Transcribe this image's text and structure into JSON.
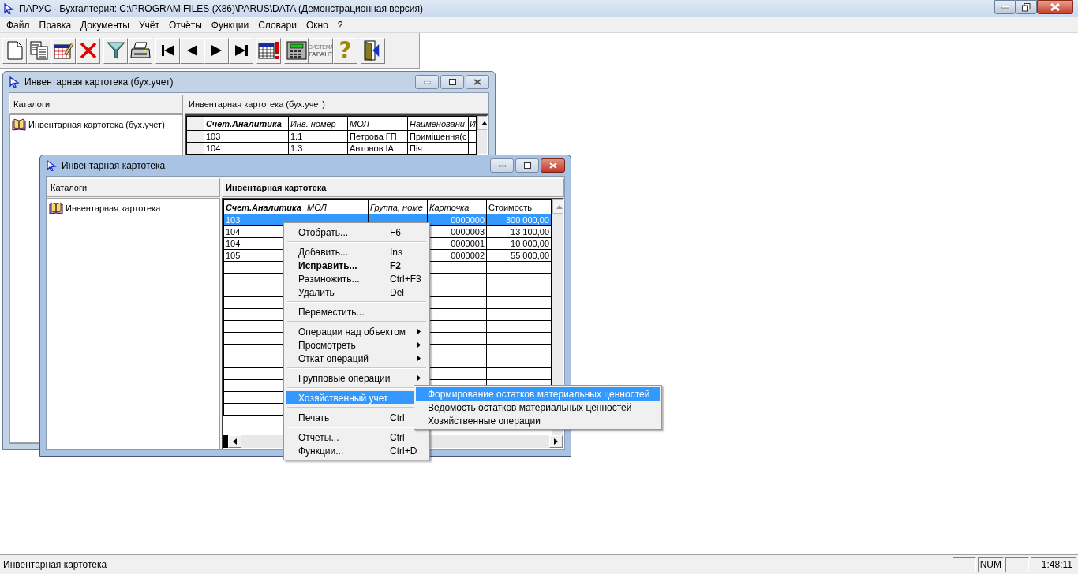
{
  "app_window": {
    "title": "ПАРУС - Бухгалтерия: C:\\PROGRAM FILES (X86)\\PARUS\\DATA (Демонстрационная версия)"
  },
  "menu_bar": [
    "Файл",
    "Правка",
    "Документы",
    "Учёт",
    "Отчёты",
    "Функции",
    "Словари",
    "Окно",
    "?"
  ],
  "toolbar": [
    [
      {
        "kind": "new"
      },
      {
        "kind": "copy"
      },
      {
        "kind": "edit"
      },
      {
        "kind": "delete"
      }
    ],
    [
      {
        "kind": "filter"
      },
      {
        "kind": "print"
      }
    ],
    [
      {
        "kind": "first"
      },
      {
        "kind": "prev"
      },
      {
        "kind": "next"
      },
      {
        "kind": "last"
      }
    ],
    [
      {
        "kind": "alert"
      }
    ],
    [
      {
        "kind": "calculator"
      },
      {
        "kind": "logo",
        "lines": [
          "СИСТЕМА",
          "ГАРАНТ"
        ],
        "disabled": true
      },
      {
        "kind": "help",
        "text": "?"
      }
    ],
    [
      {
        "kind": "exit"
      }
    ]
  ],
  "windows": [
    {
      "title": "Инвентарная картотека (бух.учет)",
      "active": false,
      "catalog_header": "Каталоги",
      "tree_item": "Инвентарная картотека (бух.учет)",
      "list_header": "Инвентарная картотека (бух.учет)",
      "row_selector": true,
      "columns": [
        "Счет.Аналитика",
        "Инв. номер",
        "МОЛ",
        "Наименовани",
        "И"
      ],
      "rows": [
        {
          "selected": false,
          "cells": [
            "103",
            "1.1",
            "Петрова ГП",
            "Приміщення(с",
            null
          ]
        },
        {
          "selected": false,
          "cells": [
            "104",
            "1.3",
            "Антонов ІА",
            "Піч",
            null
          ]
        }
      ]
    },
    {
      "title": "Инвентарная картотека",
      "active": true,
      "catalog_header": "Каталоги",
      "tree_item": "Инвентарная картотека",
      "list_header": "Инвентарная картотека",
      "row_selector": false,
      "columns": [
        "Счет.Аналитика",
        "МОЛ",
        "Группа, номе",
        "Карточка",
        "Стоимость"
      ],
      "rows": [
        {
          "selected": true,
          "cells": [
            "103",
            null,
            null,
            "0000000",
            "300 000,00"
          ]
        },
        {
          "selected": false,
          "cells": [
            "104",
            null,
            null,
            "0000003",
            "13 100,00"
          ]
        },
        {
          "selected": false,
          "cells": [
            "104",
            null,
            null,
            "0000001",
            "10 000,00"
          ]
        },
        {
          "selected": false,
          "cells": [
            "105",
            null,
            null,
            "0000002",
            "55 000,00"
          ]
        }
      ]
    }
  ],
  "context_menu": [
    {
      "kind": "item",
      "label": "Отобрать...",
      "shortcut": "F6",
      "bold": false,
      "submenu": false,
      "selected": false
    },
    {
      "kind": "separator"
    },
    {
      "kind": "item",
      "label": "Добавить...",
      "shortcut": "Ins",
      "bold": false,
      "submenu": false,
      "selected": false
    },
    {
      "kind": "item",
      "label": "Исправить...",
      "shortcut": "F2",
      "bold": true,
      "submenu": false,
      "selected": false
    },
    {
      "kind": "item",
      "label": "Размножить...",
      "shortcut": "Ctrl+F3",
      "bold": false,
      "submenu": false,
      "selected": false
    },
    {
      "kind": "item",
      "label": "Удалить",
      "shortcut": "Del",
      "bold": false,
      "submenu": false,
      "selected": false
    },
    {
      "kind": "separator"
    },
    {
      "kind": "item",
      "label": "Переместить...",
      "bold": false,
      "submenu": false,
      "selected": false
    },
    {
      "kind": "separator"
    },
    {
      "kind": "item",
      "label": "Операции над объектом",
      "bold": false,
      "submenu": true,
      "selected": false
    },
    {
      "kind": "item",
      "label": "Просмотреть",
      "bold": false,
      "submenu": true,
      "selected": false
    },
    {
      "kind": "item",
      "label": "Откат операций",
      "bold": false,
      "submenu": true,
      "selected": false
    },
    {
      "kind": "separator"
    },
    {
      "kind": "item",
      "label": "Групповые операции",
      "bold": false,
      "submenu": true,
      "selected": false
    },
    {
      "kind": "separator"
    },
    {
      "kind": "item",
      "label": "Хозяйственный учет",
      "bold": false,
      "submenu": false,
      "selected": true
    },
    {
      "kind": "separator"
    },
    {
      "kind": "item",
      "label": "Печать",
      "shortcut": "Ctrl",
      "bold": false,
      "submenu": false,
      "selected": false
    },
    {
      "kind": "separator"
    },
    {
      "kind": "item",
      "label": "Отчеты...",
      "shortcut": "Ctrl",
      "bold": false,
      "submenu": false,
      "selected": false
    },
    {
      "kind": "item",
      "label": "Функции...",
      "shortcut": "Ctrl+D",
      "bold": false,
      "submenu": false,
      "selected": false
    }
  ],
  "submenu": [
    {
      "label": "Формирование остатков материальных ценностей",
      "selected": true
    },
    {
      "label": "Ведомость остатков материальных ценностей",
      "selected": false
    },
    {
      "label": "Хозяйственные операции",
      "selected": false
    }
  ],
  "status_bar": {
    "text": "Инвентарная картотека",
    "panels": [
      {
        "kind": "blank"
      },
      {
        "kind": "text",
        "text": "NUM"
      },
      {
        "kind": "blank"
      },
      {
        "kind": "text",
        "text": "1:48:11"
      }
    ]
  }
}
